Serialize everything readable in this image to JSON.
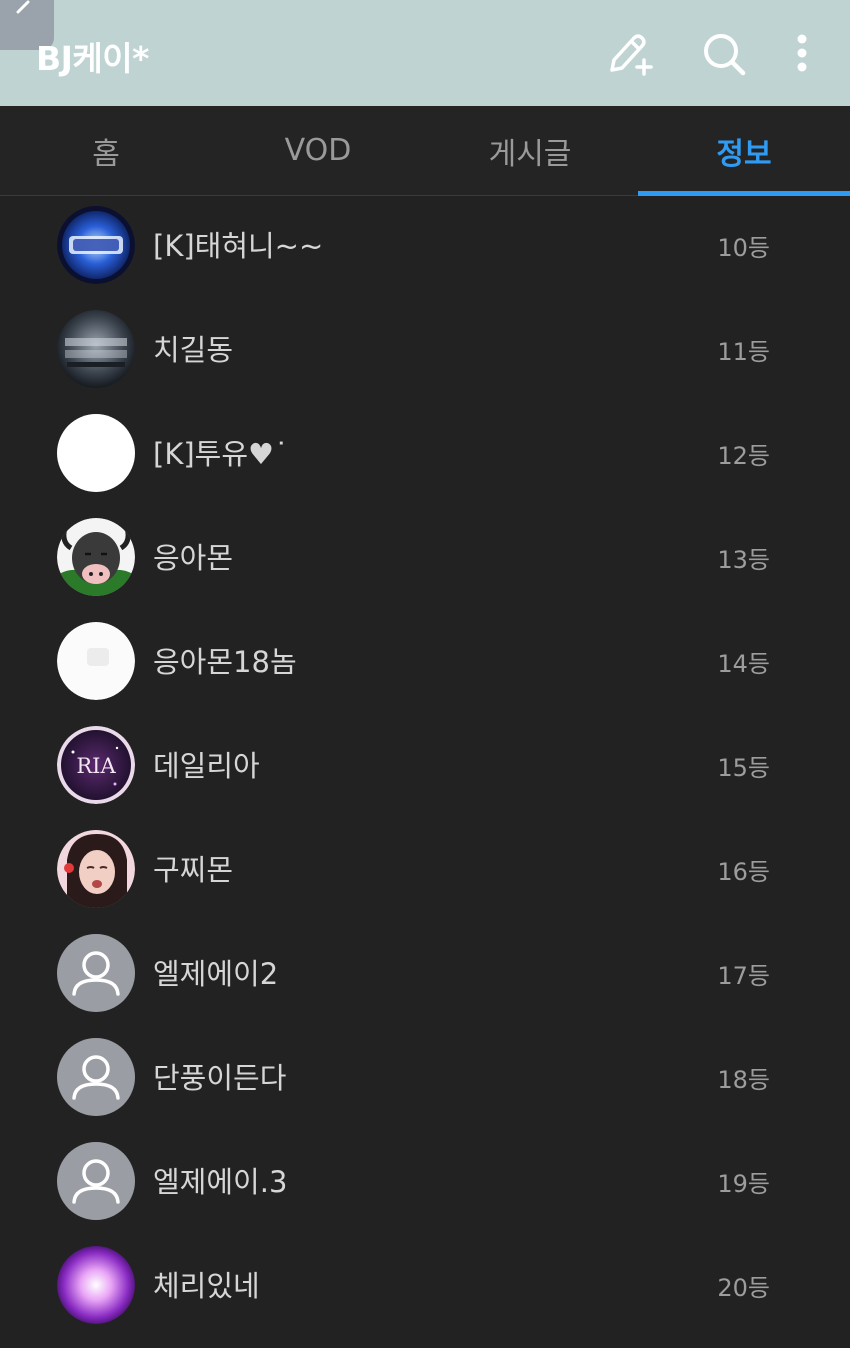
{
  "header": {
    "title": "BJ케이*",
    "background": "#bfd3d3"
  },
  "tabs": [
    {
      "label": "홈",
      "active": false
    },
    {
      "label": "VOD",
      "active": false
    },
    {
      "label": "게시글",
      "active": false
    },
    {
      "label": "정보",
      "active": true
    }
  ],
  "accent_color": "#2f9bf2",
  "ranking": [
    {
      "name": "[K]태혀니~~",
      "rank": "10등",
      "avatar": "blue-logo-avatar"
    },
    {
      "name": "치길동",
      "rank": "11등",
      "avatar": "dark-metal-logo-avatar"
    },
    {
      "name": "[K]투유♥˙",
      "rank": "12등",
      "avatar": "white-blank-avatar"
    },
    {
      "name": "응아몬",
      "rank": "13등",
      "avatar": "cow-avatar"
    },
    {
      "name": "응아몬18놈",
      "rank": "14등",
      "avatar": "white-photo-avatar"
    },
    {
      "name": "데일리아",
      "rank": "15등",
      "avatar": "ria-logo-avatar",
      "avatar_text": "RIA"
    },
    {
      "name": "구찌몬",
      "rank": "16등",
      "avatar": "person-photo-avatar"
    },
    {
      "name": "엘제에이2",
      "rank": "17등",
      "avatar": "default-user-avatar"
    },
    {
      "name": "단풍이든다",
      "rank": "18등",
      "avatar": "default-user-avatar"
    },
    {
      "name": "엘제에이.3",
      "rank": "19등",
      "avatar": "default-user-avatar"
    },
    {
      "name": "체리있네",
      "rank": "20등",
      "avatar": "purple-glow-avatar"
    }
  ]
}
